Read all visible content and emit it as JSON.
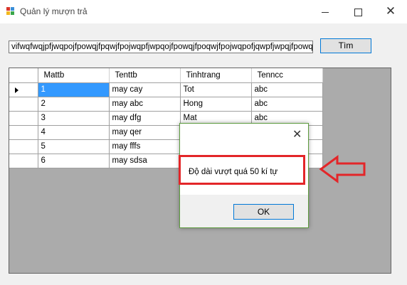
{
  "window": {
    "title": "Quản lý mượn trả",
    "minimize_glyph": "",
    "close_glyph": "✕"
  },
  "search": {
    "value": "vifwqfwqjpfjwqpojfpowqjfpqwjfpojwqpfjwpqojfpowqjfpoqwjfpojwqpofjqwpfjwpqjfpowqjfpowq",
    "button_label": "Tìm"
  },
  "grid": {
    "columns": [
      "Mattb",
      "Tenttb",
      "Tinhtrang",
      "Tenncc"
    ],
    "rows": [
      [
        "1",
        "may cay",
        "Tot",
        "abc"
      ],
      [
        "2",
        "may abc",
        "Hong",
        "abc"
      ],
      [
        "3",
        "may dfg",
        "Mat",
        "abc"
      ],
      [
        "4",
        "may qer",
        "",
        ""
      ],
      [
        "5",
        "may fffs",
        "",
        ""
      ],
      [
        "6",
        "may sdsa",
        "",
        ""
      ]
    ],
    "selected_row": 0
  },
  "dialog": {
    "message": "Độ dài vượt quá 50 kí tự",
    "ok_label": "OK",
    "close_glyph": "✕"
  },
  "colors": {
    "highlight": "#e32629",
    "selection": "#3399ff",
    "accent": "#0078d7"
  }
}
